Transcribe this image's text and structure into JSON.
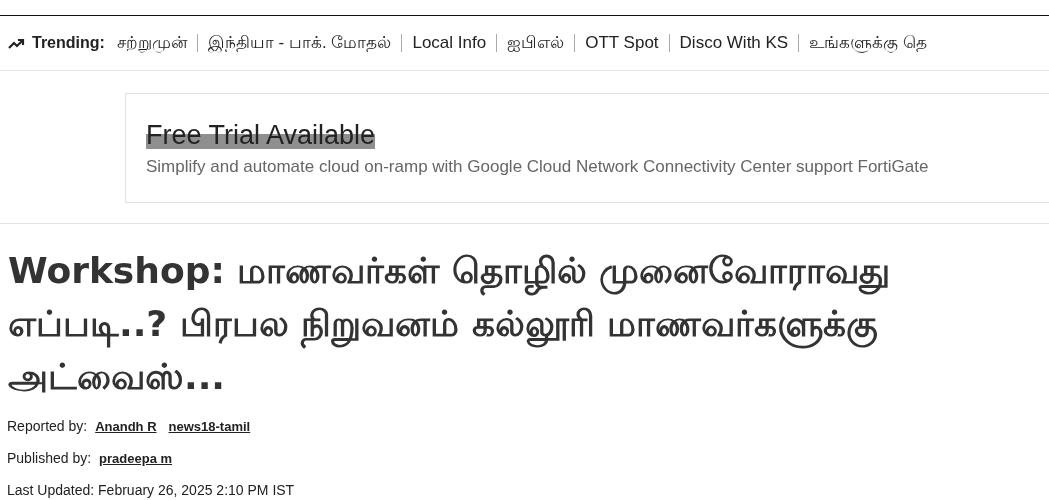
{
  "trending": {
    "label": "Trending:",
    "items": [
      "சற்றுமுன்",
      "இந்தியா - பாக். மோதல்",
      "Local Info",
      "ஐபிஎல்",
      "OTT Spot",
      "Disco With KS",
      "உங்களுக்கு தெ"
    ]
  },
  "ad": {
    "title": "Free Trial Available",
    "text": "Simplify and automate cloud on-ramp with Google Cloud Network Connectivity Center support FortiGate"
  },
  "article": {
    "headline": "Workshop: மாணவர்கள் தொழில் முனைவோராவது எப்படி..? பிரபல நிறுவனம் கல்லூரி மாணவர்களுக்கு அட்வைஸ்...",
    "meta": [
      {
        "label": "Reported by:",
        "links": [
          "Anandh R",
          "news18-tamil"
        ]
      },
      {
        "label": "Published by:",
        "links": [
          "pradeepa m"
        ]
      },
      {
        "label": "Last Updated: February 26, 2025 2:10 PM IST"
      }
    ]
  }
}
